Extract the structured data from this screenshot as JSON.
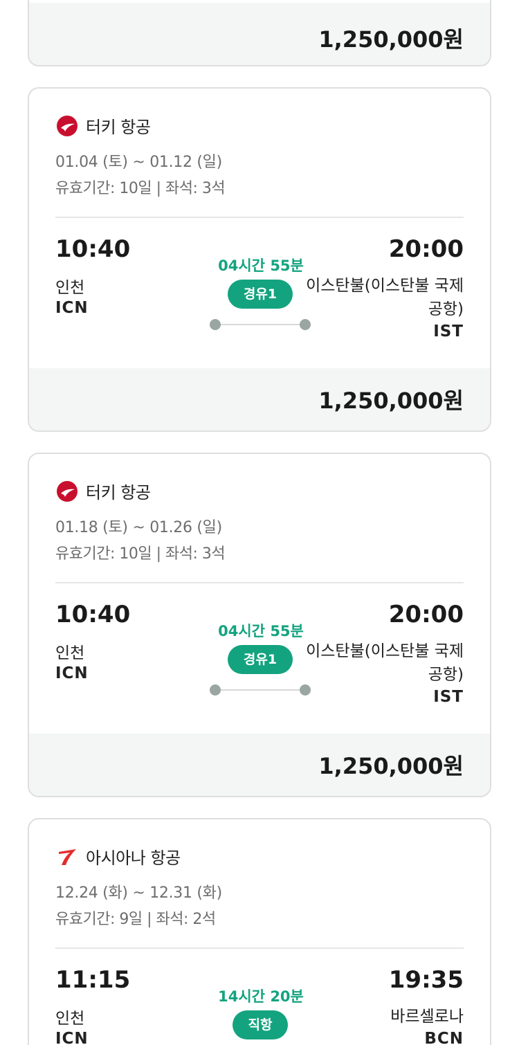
{
  "card0": {
    "price": "1,250,000원"
  },
  "card1": {
    "airline": "터키 항공",
    "dates": "01.04 (토) ~ 01.12 (일)",
    "meta": "유효기간: 10일 | 좌석: 3석",
    "dep_time": "10:40",
    "dep_city": "인천",
    "dep_code": "ICN",
    "duration": "04시간 55분",
    "stops": "경유1",
    "arr_time": "20:00",
    "arr_city": "이스탄불(이스탄불 국제공항)",
    "arr_code": "IST",
    "price": "1,250,000원"
  },
  "card2": {
    "airline": "터키 항공",
    "dates": "01.18 (토) ~ 01.26 (일)",
    "meta": "유효기간: 10일 | 좌석: 3석",
    "dep_time": "10:40",
    "dep_city": "인천",
    "dep_code": "ICN",
    "duration": "04시간 55분",
    "stops": "경유1",
    "arr_time": "20:00",
    "arr_city": "이스탄불(이스탄불 국제공항)",
    "arr_code": "IST",
    "price": "1,250,000원"
  },
  "card3": {
    "airline": "아시아나 항공",
    "dates": "12.24 (화) ~ 12.31 (화)",
    "meta": "유효기간: 9일 | 좌석: 2석",
    "dep_time": "11:15",
    "dep_city": "인천",
    "dep_code": "ICN",
    "duration": "14시간 20분",
    "stops": "직항",
    "arr_time": "19:35",
    "arr_city": "바르셀로나",
    "arr_code": "BCN"
  },
  "icons": {
    "turkish": "turkish-airlines-logo-icon",
    "asiana": "asiana-airlines-logo-icon"
  },
  "colors": {
    "accent": "#14a37f",
    "turkish_red": "#c8102e",
    "asiana_red": "#e52b2b",
    "price_bg": "#f4f5f5"
  }
}
